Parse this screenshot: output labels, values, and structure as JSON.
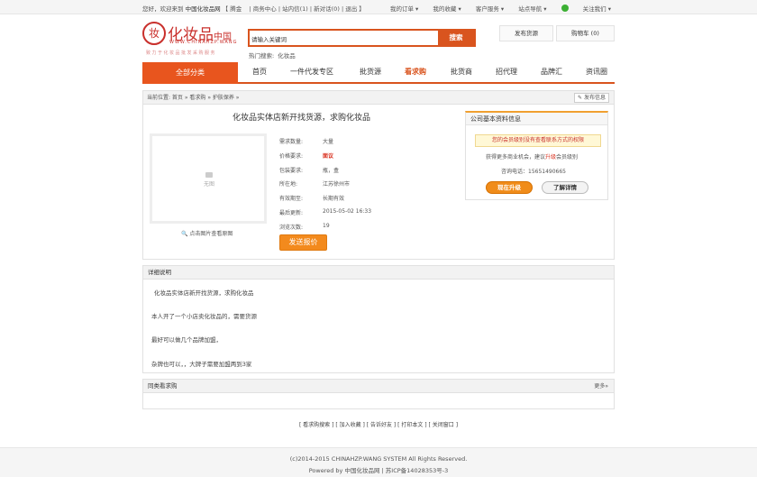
{
  "topbar": {
    "welcome": "您好，欢迎来到",
    "site": "中国化妆品网",
    "user": "【 腾金",
    "links": [
      "| 商务中心",
      "| 站内信(1)",
      "| 新对话(0)",
      "| 退出 】"
    ],
    "right": [
      "我的订单 ▾",
      "我的收藏 ▾",
      "客户服务 ▾",
      "站点导航 ▾",
      "关注我们 ▾"
    ]
  },
  "logo": {
    "mark": "妆",
    "brand": "化妆品",
    "brand_suffix": "中国",
    "url": "WWW.CHINAHZP.WANG",
    "slogan": "致力于化妆品批发采购服务"
  },
  "search": {
    "value": "请输入关键词",
    "button": "搜索",
    "hot_label": "热门搜索:",
    "hot_terms": [
      "化妆品"
    ]
  },
  "header_buttons": {
    "post": "发布货源",
    "cart": "购物车 (0)"
  },
  "nav": {
    "all": "全部分类",
    "items": [
      "首页",
      "一件代发专区",
      "批货源",
      "看求购",
      "批货商",
      "招代理",
      "品牌汇",
      "资讯圈"
    ],
    "active_index": 3
  },
  "breadcrumb": {
    "text": "当前位置: 首页 » 看求购 » 护肤保养 »",
    "post_button": "发布信息"
  },
  "product": {
    "title": "化妆品实体店新开找货源，求购化妆品",
    "no_image": "无图",
    "view_image": "点击图片查看原图",
    "fields": [
      {
        "label": "需求数量:",
        "value": "大量"
      },
      {
        "label": "价格要求:",
        "value": "面议"
      },
      {
        "label": "包装要求:",
        "value": "瓶，盒"
      },
      {
        "label": "所在地:",
        "value": "江苏徐州市"
      },
      {
        "label": "有效期至:",
        "value": "长期有效"
      },
      {
        "label": "最后更新:",
        "value": "2015-05-02 16:33"
      },
      {
        "label": "浏览次数:",
        "value": "19"
      }
    ],
    "offer_button": "发送报价"
  },
  "company": {
    "title": "公司基本资料信息",
    "warning": "您的会员级别没有查看联系方式的权限",
    "tip_pre": "获得更多商业机会，建议",
    "tip_upgrade": "升级",
    "tip_post": "会员级别",
    "tel": "咨询电话：15651490665",
    "upgrade_button": "现在升级",
    "details_button": "了解详情"
  },
  "details": {
    "title": "详细说明",
    "lines": [
      "化妆品实体店新开找货源，求购化妆品",
      "本人开了一个小店卖化妆品的，需要货源",
      "最好可以做几个品牌加盟，",
      "杂牌也可以，，大牌子需要加盟两到3家"
    ]
  },
  "similar": {
    "title": "同类看求购",
    "more": "更多»"
  },
  "bottom_links": "[ 看求购搜索 ]  [ 加入收藏 ]  [ 告诉好友 ]  [ 打印本文 ]  [ 关闭窗口 ]",
  "footer": {
    "copyright": "(c)2014-2015 CHINAHZP.WANG SYSTEM All Rights Reserved.",
    "powered": "Powered by 中国化妆品网 | 苏ICP备14028353号-3"
  }
}
